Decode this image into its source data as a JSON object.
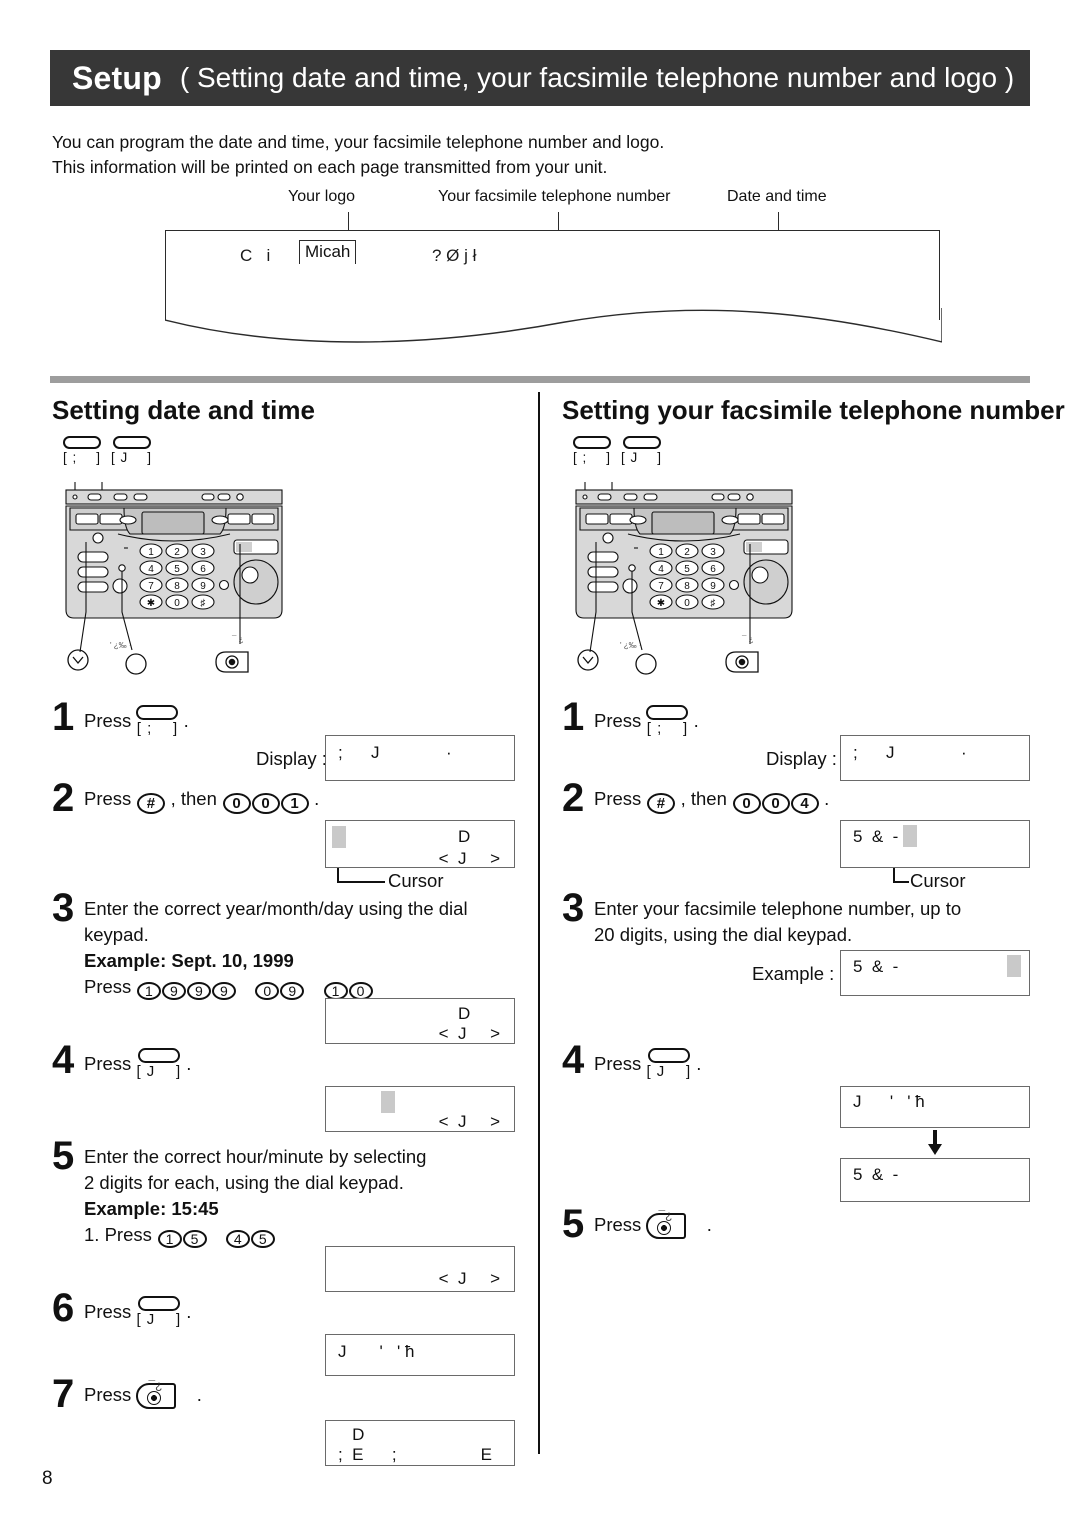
{
  "header": {
    "title": "Setup",
    "subtitle": "( Setting date and time, your facsimile telephone number and logo )"
  },
  "intro": {
    "line1": "You can program the date and time, your facsimile telephone number and logo.",
    "line2": "This information will be printed on each page transmitted from your unit."
  },
  "sample_header": {
    "callouts": {
      "logo": "Your logo",
      "fax_number": "Your facsimile telephone  number",
      "date_time": "Date and time"
    },
    "printed_text_left": "C   i",
    "printed_logo": "Micah",
    "printed_text_right": "? Ø j ł"
  },
  "left_section": {
    "title": "Setting date and time",
    "keys_above": [
      {
        "label": "[ ;    ]"
      },
      {
        "label": "[ J    ]"
      }
    ],
    "steps": [
      {
        "num": "1",
        "text_before": "Press",
        "key": "[ ;    ]",
        "text_after": ".",
        "display_label": "Display :",
        "lcd": {
          "l1": ";      J",
          "l2": "",
          "tick": "·"
        }
      },
      {
        "num": "2",
        "text_before": "Press",
        "hash_key": "#",
        "text_mid": ", then",
        "digits": [
          "0",
          "0",
          "1"
        ],
        "text_after": ".",
        "lcd": {
          "l1": "",
          "c1": "D",
          "r2": "<  J     >"
        },
        "cursor_label": "Cursor"
      },
      {
        "num": "3",
        "line1": "Enter the correct year/month/day using the dial",
        "line2": "keypad.",
        "example_title": "Example: Sept. 10, 1999",
        "press_label": "Press",
        "press_digits": [
          "1",
          "9",
          "9",
          "9",
          "0",
          "9",
          "1",
          "0"
        ],
        "lcd": {
          "c1": "D",
          "r2": "<  J     >"
        }
      },
      {
        "num": "4",
        "text_before": "Press",
        "key": "[ J    ]",
        "text_after": ".",
        "lcd": {
          "r2": "<  J     >"
        }
      },
      {
        "num": "5",
        "line1": "Enter the correct hour/minute by selecting",
        "line2": "2 digits for each, using the dial keypad.",
        "example_title": "Example: 15:45",
        "press_label": "1. Press",
        "press_digits": [
          "1",
          "5",
          "4",
          "5"
        ],
        "lcd": {
          "r2": "<  J     >"
        }
      },
      {
        "num": "6",
        "text_before": "Press",
        "key": "[ J    ]",
        "text_after": ".",
        "lcd": {
          "l1": "J       '   ' ħ"
        }
      },
      {
        "num": "7",
        "text_before": "Press",
        "key_icon": "start-stop-key",
        "text_after": ".",
        "lcd": {
          "l1": "   D",
          "l2": ";  E      ;",
          "r2": "E"
        }
      }
    ]
  },
  "right_section": {
    "title": "Setting your facsimile telephone number",
    "keys_above": [
      {
        "label": "[ ;    ]"
      },
      {
        "label": "[ J    ]"
      }
    ],
    "steps": [
      {
        "num": "1",
        "text_before": "Press",
        "key": "[ ;    ]",
        "text_after": ".",
        "display_label": "Display :",
        "lcd": {
          "l1": ";      J",
          "tick": "·"
        }
      },
      {
        "num": "2",
        "text_before": "Press",
        "hash_key": "#",
        "text_mid": ", then",
        "digits": [
          "0",
          "0",
          "4"
        ],
        "text_after": ".",
        "lcd": {
          "l1": "5  &  -"
        },
        "cursor_label": "Cursor"
      },
      {
        "num": "3",
        "line1": "Enter your facsimile telephone number, up to",
        "line2": "20 digits, using the dial keypad.",
        "example_label": "Example :",
        "lcd": {
          "l1": "5  &  -"
        }
      },
      {
        "num": "4",
        "text_before": "Press",
        "key": "[ J    ]",
        "text_after": ".",
        "lcd_top": {
          "l1": "J      '   ' ħ"
        },
        "lcd_bottom": {
          "l1": "5  &  -"
        }
      },
      {
        "num": "5",
        "text_before": "Press",
        "key_icon": "start-stop-key",
        "text_after": "."
      }
    ]
  },
  "fax_machine": {
    "keypad_digits": [
      "1",
      "2",
      "3",
      "4",
      "5",
      "6",
      "7",
      "8",
      "9",
      "∗",
      "0",
      "♯"
    ],
    "callout_left": "▼",
    "callout_mid": "'  ¿‰  ·",
    "callout_right": "¯ ¿"
  },
  "page_number": "8",
  "colors": {
    "header_bar": "#373737",
    "grey_rule": "#9d9d9d",
    "lcd_border": "#6a6a6a",
    "cursor": "#c9c9c9",
    "machine_body": "#d8d8d8",
    "machine_dark": "#b6b6b6"
  }
}
